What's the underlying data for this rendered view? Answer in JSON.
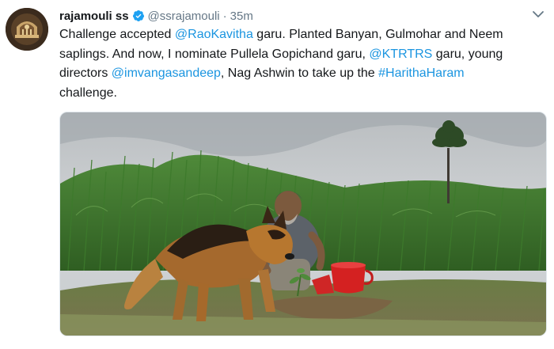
{
  "tweet": {
    "display_name": "rajamouli ss",
    "handle": "@ssrajamouli",
    "separator": "·",
    "time": "35m",
    "verified": true,
    "lines": [
      [
        {
          "text": "Challenge accepted ",
          "type": "text"
        },
        {
          "text": "@RaoKavitha",
          "type": "mention"
        },
        {
          "text": " garu. Planted Banyan, Gulmohar and Neem",
          "type": "text"
        }
      ],
      [
        {
          "text": "saplings. And now, I nominate Pullela Gopichand garu, ",
          "type": "text"
        },
        {
          "text": "@KTRTRS",
          "type": "mention"
        },
        {
          "text": " garu, young",
          "type": "text"
        }
      ],
      [
        {
          "text": "directors ",
          "type": "text"
        },
        {
          "text": "@imvangasandeep",
          "type": "mention"
        },
        {
          "text": ", Nag Ashwin to take up the ",
          "type": "text"
        },
        {
          "text": "#HarithaHaram",
          "type": "hashtag"
        }
      ],
      [
        {
          "text": "challenge.",
          "type": "text"
        }
      ]
    ]
  },
  "colors": {
    "link": "#1b95e0",
    "verified_badge": "#1da1f2",
    "text": "#14171a",
    "secondary": "#657786"
  },
  "icons": {
    "verified": "verified-badge-icon",
    "caret": "chevron-down-icon"
  }
}
